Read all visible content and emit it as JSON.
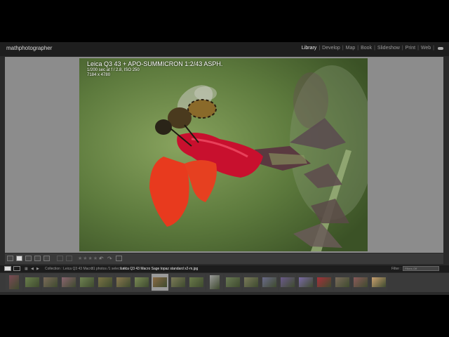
{
  "app_name": "mathphotographer",
  "modules": [
    {
      "label": "Library",
      "active": true
    },
    {
      "label": "Develop",
      "active": false
    },
    {
      "label": "Map",
      "active": false
    },
    {
      "label": "Book",
      "active": false
    },
    {
      "label": "Slideshow",
      "active": false
    },
    {
      "label": "Print",
      "active": false
    },
    {
      "label": "Web",
      "active": false
    }
  ],
  "photo_info": {
    "title": "Leica Q3 43 + APO-SUMMICRON 1:2/43 ASPH.",
    "exif": "1/200 sec at f / 2.8, ISO 250",
    "dimensions": "7184 x 4780"
  },
  "toolbar": {
    "view_buttons": [
      "grid-view-icon",
      "loupe-view-icon",
      "compare-view-icon",
      "survey-view-icon",
      "people-view-icon"
    ],
    "rating_stars": "★★★★★"
  },
  "filmstrip_bar": {
    "collection": "Collection : Leica Q3 43 Macro",
    "selection": "31 photos /1 selected /",
    "filename": "Leica Q3 43 Macro Sage topaz standard x2-m.jpg",
    "filter_label": "Filter :",
    "filter_value": "Filters Off"
  },
  "filmstrip": {
    "thumbs": [
      {
        "color": "#7a4a55",
        "portrait": true
      },
      {
        "color": "#6a7f4c"
      },
      {
        "color": "#7b6a5a"
      },
      {
        "color": "#8a6470"
      },
      {
        "color": "#6f8252"
      },
      {
        "color": "#7a7345"
      },
      {
        "color": "#8a7850"
      },
      {
        "color": "#7a8a55"
      },
      {
        "color": "#8a6a45",
        "selected": true
      },
      {
        "color": "#7c7a58"
      },
      {
        "color": "#6a7a4a"
      },
      {
        "color": "#9a9a9a",
        "portrait": true
      },
      {
        "color": "#6a7a54"
      },
      {
        "color": "#7a7a5a"
      },
      {
        "color": "#6a6a8a"
      },
      {
        "color": "#6a5a8a"
      },
      {
        "color": "#7a6aa5"
      },
      {
        "color": "#a5303a"
      },
      {
        "color": "#7a6a5a"
      },
      {
        "color": "#8a5a5a"
      },
      {
        "color": "#c8a070"
      }
    ]
  }
}
